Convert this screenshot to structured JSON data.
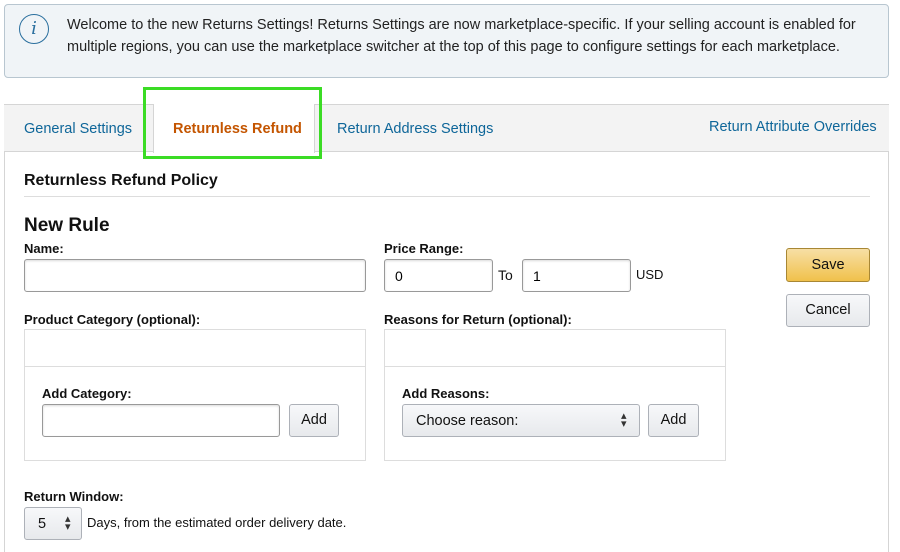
{
  "banner": {
    "icon": "info-icon",
    "text": "Welcome to the new Returns Settings! Returns Settings are now marketplace-specific. If your selling account is enabled for multiple regions, you can use the marketplace switcher at the top of this page to configure settings for each marketplace."
  },
  "tabs": {
    "general": "General Settings",
    "returnless": "Returnless Refund",
    "return_address": "Return Address Settings",
    "attribute_overrides": "Return Attribute Overrides"
  },
  "policy": {
    "section_title": "Returnless Refund Policy",
    "rule_title": "New Rule",
    "name_label": "Name:",
    "name_value": "",
    "price_range_label": "Price Range:",
    "price_from": "0",
    "price_to_label": "To",
    "price_to": "1",
    "currency": "USD",
    "save_label": "Save",
    "cancel_label": "Cancel",
    "category_label": "Product Category (optional):",
    "add_category_label": "Add Category:",
    "category_value": "",
    "add_label": "Add",
    "reasons_label": "Reasons for Return (optional):",
    "add_reasons_label": "Add Reasons:",
    "reason_selected": "Choose reason:",
    "return_window_label": "Return Window:",
    "return_window_value": "5",
    "return_window_text": "Days, from the estimated order delivery date."
  },
  "colors": {
    "link": "#0e6699",
    "active_tab": "#c45500",
    "highlight": "#3bdc25",
    "save_button": "#f0c14b"
  }
}
